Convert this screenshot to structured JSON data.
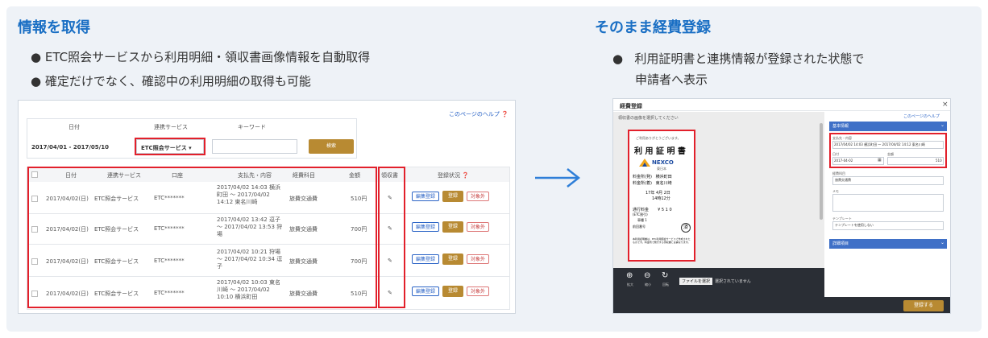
{
  "left": {
    "heading": "情報を取得",
    "bullets": [
      "ETC照会サービスから利用明細・領収書画像情報を自動取得",
      "確定だけでなく、確認中の利用明細の取得も可能"
    ],
    "help_link": "このページのヘルプ",
    "search": {
      "date_header": "日付",
      "service_header": "連携サービス",
      "keyword_header": "キーワード",
      "date_value": "2017/04/01 - 2017/05/10",
      "service_value": "ETC照会サービス",
      "search_button": "検索"
    },
    "table": {
      "columns": [
        "日付",
        "連携サービス",
        "口座",
        "支払先・内容",
        "経費科目",
        "金額",
        "領収書",
        "登録状況"
      ],
      "rows": [
        {
          "date": "2017/04/02(日)",
          "service": "ETC照会サービス",
          "account": "ETC*******",
          "content": "2017/04/02 14:03 横浜町田 ～ 2017/04/02 14:12 東名川崎",
          "category": "旅費交通費",
          "amount": "510円"
        },
        {
          "date": "2017/04/02(日)",
          "service": "ETC照会サービス",
          "account": "ETC*******",
          "content": "2017/04/02 13:42 逗子 ～ 2017/04/02 13:53 狩場",
          "category": "旅費交通費",
          "amount": "700円"
        },
        {
          "date": "2017/04/02(日)",
          "service": "ETC照会サービス",
          "account": "ETC*******",
          "content": "2017/04/02 10:21 狩場 ～ 2017/04/02 10:34 逗子",
          "category": "旅費交通費",
          "amount": "700円"
        },
        {
          "date": "2017/04/02(日)",
          "service": "ETC照会サービス",
          "account": "ETC*******",
          "content": "2017/04/02 10:03 東名川崎 ～ 2017/04/02 10:10 横浜町田",
          "category": "旅費交通費",
          "amount": "510円"
        }
      ],
      "edit_label": "編集登録",
      "register_label": "登録",
      "exclude_label": "対象外",
      "receipt_icon": "✎"
    }
  },
  "right": {
    "heading": "そのまま経費登録",
    "bullets": [
      "利用証明書と連携情報が登録された状態で",
      "申請者へ表示"
    ],
    "dialog_title": "経費登録",
    "help_link": "このページのヘルプ",
    "image_note": "領収書の画像を選択してください",
    "receipt": {
      "lines_top": [
        "ご利用ありがとうございます。"
      ],
      "title": "利 用 証 明 書",
      "brand": "NEXCO",
      "brand_sub": "東日本",
      "lines": [
        "料金所(発)   横浜町田",
        "料金所(着)   東名川崎",
        "",
        "17年 4月 2日",
        "14時12分",
        "",
        "通行料金       ¥ 5 1 0",
        "(ETC割引)",
        "車種  1",
        "前回番号"
      ],
      "footer": "本利用証明書は、ETC利用照会サービスで作成されたものです。料金所で発行する領収書とは異なります。",
      "stamp": "済"
    },
    "toolbar": {
      "zoom_in": "拡大",
      "zoom_out": "縮小",
      "rotate": "回転",
      "file_button": "ファイルを選択",
      "file_status": "選択されていません"
    },
    "form": {
      "section_basic": "基本情報",
      "content_label": "支払先・内容",
      "content_value": "2017/04/02 14:03 横浜町田 ～ 2017/04/02 14:12 東名川崎",
      "date_label": "日付",
      "amount_label": "金額",
      "date_value": "2017-04-02",
      "amount_value": "510",
      "category_label": "経費科目",
      "category_value": "旅費交通費",
      "memo_label": "メモ",
      "template_label": "テンプレート",
      "template_value": "テンプレートを使用しない",
      "section_detail": "詳細項目",
      "save_button": "登録する"
    }
  },
  "colors": {
    "accent": "#1a6fc4",
    "red": "#e2202b",
    "gold": "#b88a32",
    "form_header": "#3f70c7"
  }
}
